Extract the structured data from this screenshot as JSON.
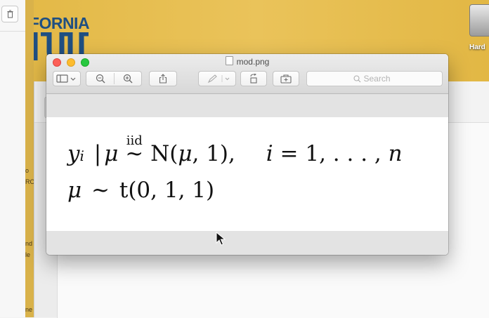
{
  "desktop": {
    "logo_text": "IFORNIA",
    "drive_label": "Hard",
    "background_color": "#e6bd4c"
  },
  "background_windows": {
    "left_strip_text": [
      "o",
      "RO",
      "nd",
      "le",
      "ne"
    ]
  },
  "preview_window": {
    "title": "mod.png",
    "traffic_lights": [
      "#fc5f57",
      "#fdbc2e",
      "#28c840"
    ],
    "toolbar": {
      "buttons": [
        {
          "name": "sidebar-view-button",
          "icon": "sidebar-icon"
        },
        {
          "name": "zoom-out-button",
          "icon": "zoom-out-icon"
        },
        {
          "name": "zoom-in-button",
          "icon": "zoom-in-icon"
        },
        {
          "name": "share-button",
          "icon": "share-icon"
        },
        {
          "name": "markup-button",
          "icon": "pen-icon"
        },
        {
          "name": "rotate-button",
          "icon": "rotate-icon"
        },
        {
          "name": "toolbox-button",
          "icon": "toolbox-icon"
        }
      ],
      "search_placeholder": "Search"
    },
    "content": {
      "line1": {
        "lhs_var": "y",
        "lhs_sub": "i",
        "given": "|",
        "mu": "μ",
        "over": "iid",
        "tilde": "~",
        "dist": "N(",
        "mu2": "μ",
        "params": ", 1),",
        "index_var": "i",
        "index_eq": "= 1, . . . ,",
        "index_end": "n"
      },
      "line2": {
        "mu": "μ",
        "tilde": "~",
        "dist": "t(0, 1, 1)"
      }
    }
  }
}
